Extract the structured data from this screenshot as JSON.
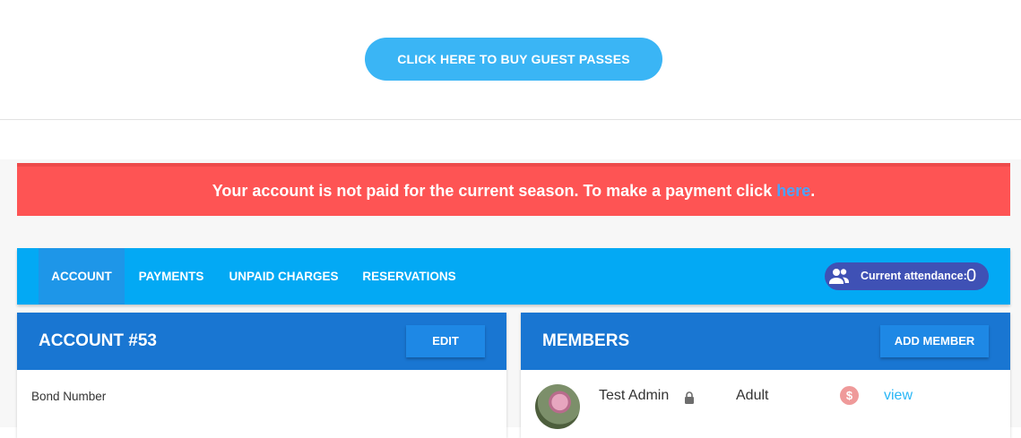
{
  "top": {
    "guest_button_label": "CLICK HERE TO BUY GUEST PASSES"
  },
  "alert": {
    "message": "Your account is not paid for the current season. To make a payment click ",
    "link_text": "here",
    "suffix": "."
  },
  "nav": {
    "tabs": [
      {
        "label": "ACCOUNT",
        "active": true
      },
      {
        "label": "PAYMENTS",
        "active": false
      },
      {
        "label": "UNPAID CHARGES",
        "active": false
      },
      {
        "label": "RESERVATIONS",
        "active": false
      }
    ],
    "attendance": {
      "label": "Current attendance:",
      "count": "0",
      "icon": "people-icon"
    }
  },
  "account_card": {
    "title": "ACCOUNT #53",
    "edit_label": "EDIT",
    "fields": [
      {
        "label": "Bond Number"
      }
    ]
  },
  "members_card": {
    "title": "MEMBERS",
    "add_label": "ADD MEMBER",
    "members": [
      {
        "name": "Test Admin",
        "type": "Adult",
        "status_symbol": "$",
        "link": "view",
        "lock_icon": "lock-icon",
        "status_icon": "dollar-icon"
      }
    ]
  },
  "colors": {
    "guest_button": "#3ab5f5",
    "alert_bg": "#fe5454",
    "nav_bg": "#03a9f4",
    "nav_active": "#1e96e8",
    "attendance_bg": "#3f51b5",
    "card_header": "#1976d2",
    "card_button": "#1e88e5",
    "status_dollar": "#ef9a9a",
    "view_link": "#29b6f6"
  }
}
